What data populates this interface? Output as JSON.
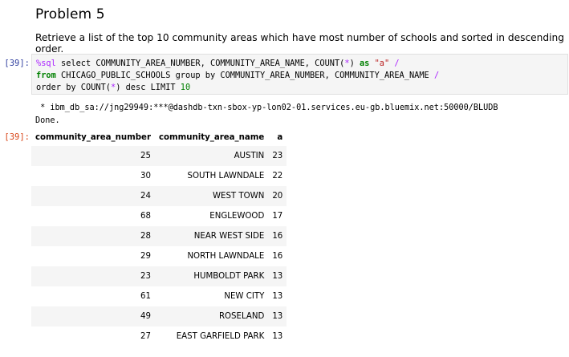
{
  "markdown": {
    "title": "Problem 5",
    "text": "Retrieve a list of the top 10 community areas which have most number of schools and sorted in descending order."
  },
  "cell": {
    "in_prompt": "[39]:",
    "out_prompt": "[39]:",
    "code": {
      "line1": {
        "magic": "%sql",
        "a": " select COMMUNITY_AREA_NUMBER, COMMUNITY_AREA_NAME, COUNT(",
        "star": "*",
        "b": ") ",
        "as_kw": "as",
        "c": " ",
        "alias_str": "\"a\"",
        "d": " ",
        "slash": "/"
      },
      "line2": {
        "from_kw": "from",
        "a": " CHICAGO_PUBLIC_SCHOOLS group by COMMUNITY_AREA_NUMBER, COMMUNITY_AREA_NAME ",
        "slash": "/"
      },
      "line3": {
        "a": "order by COUNT(",
        "star": "*",
        "b": ") desc LIMIT ",
        "limit": "10"
      }
    },
    "stream_line1": " * ibm_db_sa://jng29949:***@dashdb-txn-sbox-yp-lon02-01.services.eu-gb.bluemix.net:50000/BLUDB",
    "stream_line2": "Done."
  },
  "table": {
    "headers": [
      "community_area_number",
      "community_area_name",
      "a"
    ],
    "rows": [
      [
        "25",
        "AUSTIN",
        "23"
      ],
      [
        "30",
        "SOUTH LAWNDALE",
        "22"
      ],
      [
        "24",
        "WEST TOWN",
        "20"
      ],
      [
        "68",
        "ENGLEWOOD",
        "17"
      ],
      [
        "28",
        "NEAR WEST SIDE",
        "16"
      ],
      [
        "29",
        "NORTH LAWNDALE",
        "16"
      ],
      [
        "23",
        "HUMBOLDT PARK",
        "13"
      ],
      [
        "61",
        "NEW CITY",
        "13"
      ],
      [
        "49",
        "ROSELAND",
        "13"
      ],
      [
        "27",
        "EAST GARFIELD PARK",
        "13"
      ]
    ]
  }
}
